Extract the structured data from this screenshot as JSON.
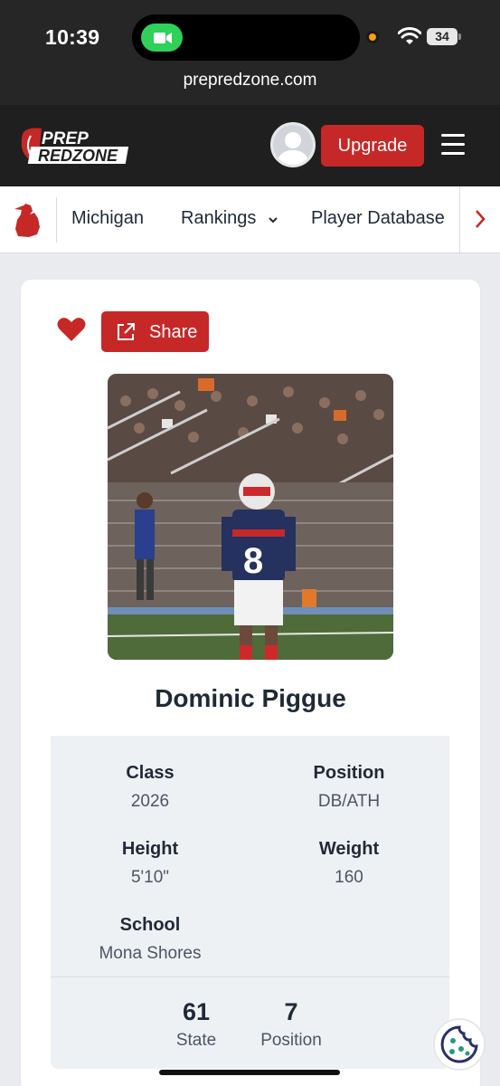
{
  "status_bar": {
    "time": "10:39",
    "battery": "34",
    "facetime_color": "#2fd158"
  },
  "browser": {
    "url": "prepredzone.com"
  },
  "header": {
    "logo_top": "PREP",
    "logo_bottom": "REDZONE",
    "upgrade_label": "Upgrade",
    "brand_color": "#c62828"
  },
  "nav": {
    "items": [
      {
        "label": "Michigan"
      },
      {
        "label": "Rankings"
      },
      {
        "label": "Player Database"
      }
    ]
  },
  "profile": {
    "share_label": "Share",
    "name": "Dominic Piggue",
    "jersey_number": "8",
    "stats": {
      "class_label": "Class",
      "class_value": "2026",
      "position_label": "Position",
      "position_value": "DB/ATH",
      "height_label": "Height",
      "height_value": "5'10\"",
      "weight_label": "Weight",
      "weight_value": "160",
      "school_label": "School",
      "school_value": "Mona Shores"
    },
    "rankings": {
      "state_rank": "61",
      "state_label": "State",
      "position_rank": "7",
      "position_label": "Position"
    }
  }
}
